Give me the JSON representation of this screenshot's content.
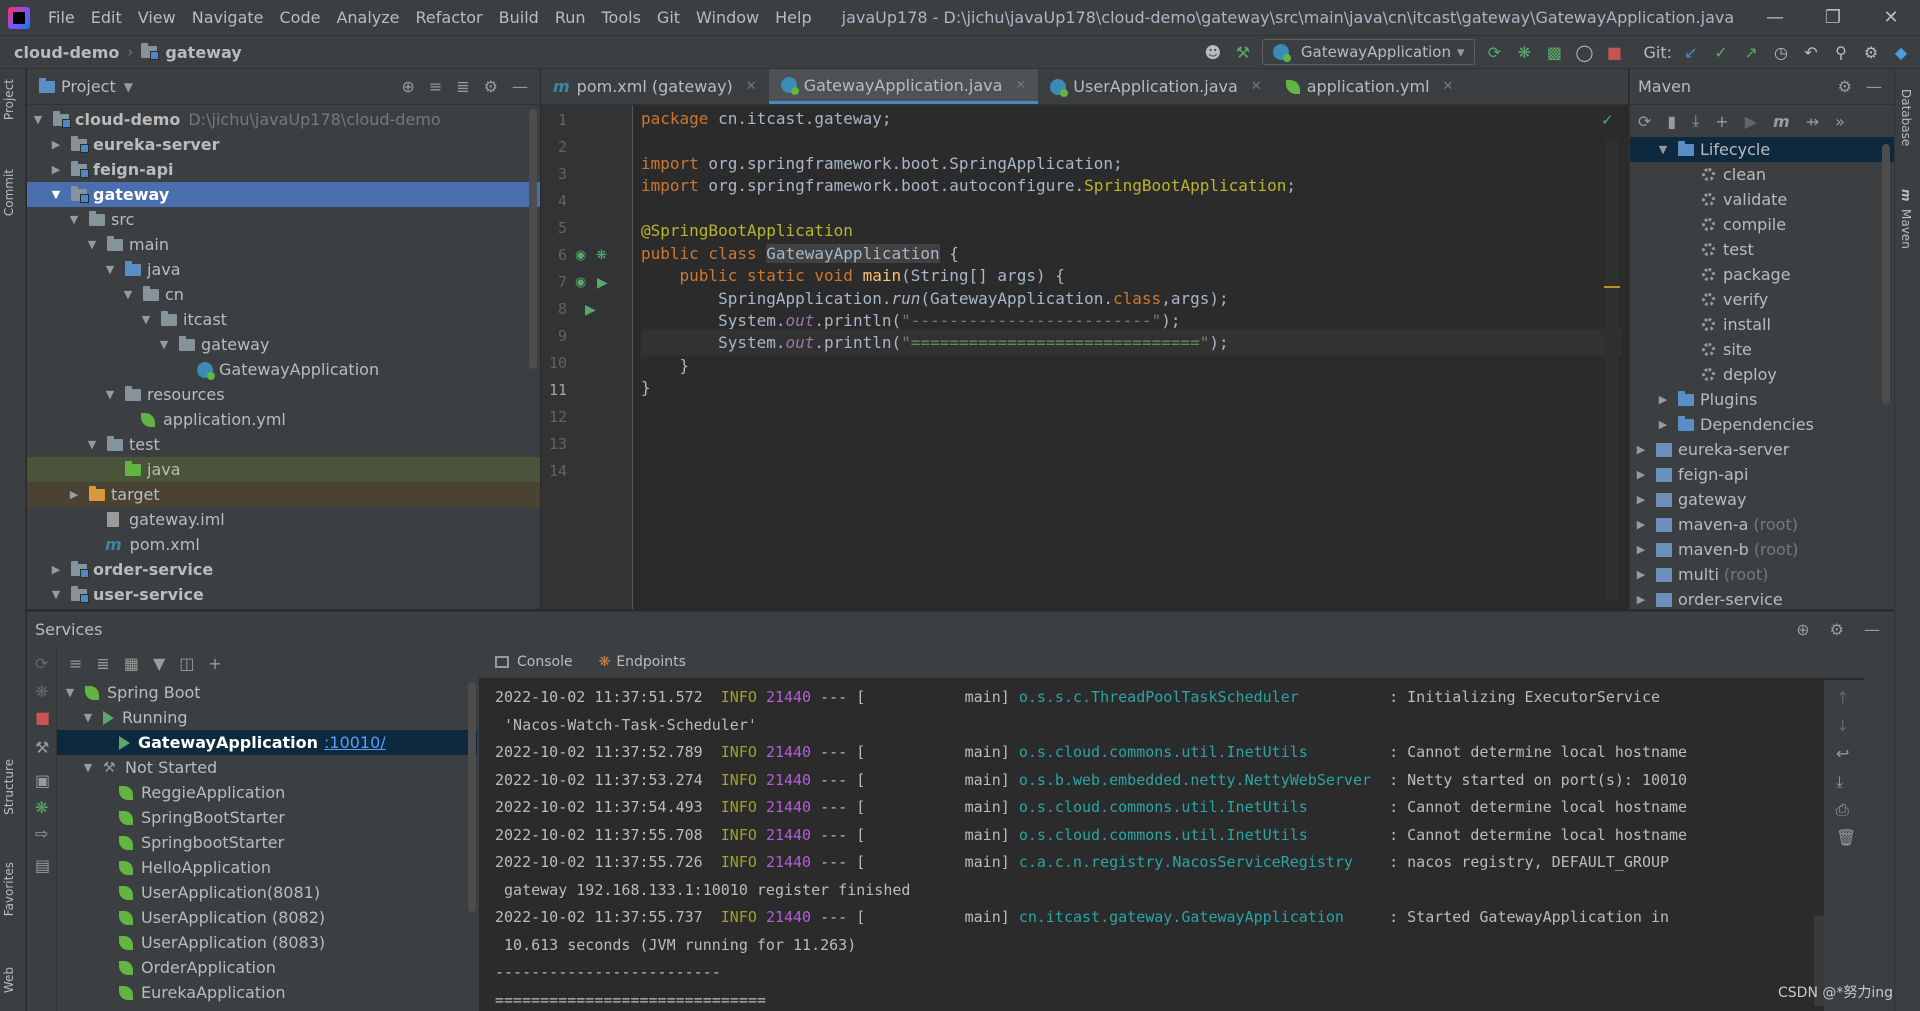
{
  "menubar": {
    "items": [
      "File",
      "Edit",
      "View",
      "Navigate",
      "Code",
      "Analyze",
      "Refactor",
      "Build",
      "Run",
      "Tools",
      "Git",
      "Window",
      "Help"
    ],
    "title": "javaUp178 - D:\\jichu\\javaUp178\\cloud-demo\\gateway\\src\\main\\java\\cn\\itcast\\gateway\\GatewayApplication.java"
  },
  "nav": {
    "crumbs": [
      "cloud-demo",
      "gateway"
    ],
    "run_config": "GatewayApplication",
    "git_label": "Git:"
  },
  "left_strip": {
    "project": "Project",
    "commit": "Commit",
    "structure": "Structure",
    "favorites": "Favorites",
    "web": "Web"
  },
  "right_strip": {
    "database": "Database",
    "maven": "Maven",
    "maven_m": "m"
  },
  "project": {
    "title": "Project",
    "tree": [
      {
        "label": "cloud-demo",
        "path": "D:\\jichu\\javaUp178\\cloud-demo"
      },
      {
        "label": "eureka-server"
      },
      {
        "label": "feign-api"
      },
      {
        "label": "gateway"
      },
      {
        "label": "src"
      },
      {
        "label": "main"
      },
      {
        "label": "java"
      },
      {
        "label": "cn"
      },
      {
        "label": "itcast"
      },
      {
        "label": "gateway"
      },
      {
        "label": "GatewayApplication"
      },
      {
        "label": "resources"
      },
      {
        "label": "application.yml"
      },
      {
        "label": "test"
      },
      {
        "label": "java"
      },
      {
        "label": "target"
      },
      {
        "label": "gateway.iml"
      },
      {
        "label": "pom.xml"
      },
      {
        "label": "order-service"
      },
      {
        "label": "user-service"
      }
    ]
  },
  "editor": {
    "tabs": [
      "pom.xml (gateway)",
      "GatewayApplication.java",
      "UserApplication.java",
      "application.yml"
    ],
    "line_numbers": [
      "1",
      "2",
      "3",
      "4",
      "5",
      "6",
      "7",
      "8",
      "9",
      "10",
      "11",
      "12",
      "13",
      "14"
    ],
    "code": {
      "l1_kw": "package",
      "l1_rest": " cn.itcast.gateway;",
      "l3_kw": "import",
      "l3_rest": " org.springframework.boot.SpringApplication;",
      "l4_kw": "import",
      "l4_rest": " org.springframework.boot.autoconfigure.",
      "l4_cls": "SpringBootApplication",
      "l4_end": ";",
      "l6": "@SpringBootApplication",
      "l7_kw": "public class ",
      "l7_cls": "GatewayApplication",
      "l7_end": " {",
      "l8_indent": "    ",
      "l8_kw": "public static void ",
      "l8_fn": "main",
      "l8_end": "(String[] args) {",
      "l9_a": "        SpringApplication.",
      "l9_run": "run",
      "l9_b": "(GatewayApplication.",
      "l9_kw": "class",
      "l9_c": ",args);",
      "l10_a": "        System.",
      "l10_out": "out",
      "l10_b": ".println(",
      "l10_str": "\"-------------------------\"",
      "l10_c": ");",
      "l11_a": "        System.",
      "l11_out": "out",
      "l11_b": ".println(",
      "l11_str": "\"==============================\"",
      "l11_c": ");",
      "l12": "    }",
      "l13": "}"
    }
  },
  "maven": {
    "title": "Maven",
    "lifecycle": "Lifecycle",
    "goals": [
      "clean",
      "validate",
      "compile",
      "test",
      "package",
      "verify",
      "install",
      "site",
      "deploy"
    ],
    "plugins": "Plugins",
    "dependencies": "Dependencies",
    "modules": [
      {
        "name": "eureka-server",
        "tag": ""
      },
      {
        "name": "feign-api",
        "tag": ""
      },
      {
        "name": "gateway",
        "tag": ""
      },
      {
        "name": "maven-a",
        "tag": "(root)"
      },
      {
        "name": "maven-b",
        "tag": "(root)"
      },
      {
        "name": "multi",
        "tag": "(root)"
      },
      {
        "name": "order-service",
        "tag": ""
      }
    ]
  },
  "services": {
    "title": "Services",
    "spring_boot": "Spring Boot",
    "running": "Running",
    "running_app": "GatewayApplication",
    "running_port": ":10010/",
    "not_started": "Not Started",
    "apps": [
      "ReggieApplication",
      "SpringBootStarter",
      "SpringbootStarter",
      "HelloApplication",
      "UserApplication(8081)",
      "UserApplication (8082)",
      "UserApplication (8083)",
      "OrderApplication",
      "EurekaApplication"
    ]
  },
  "console": {
    "tabs": [
      "Console",
      "Endpoints"
    ],
    "lines": [
      {
        "ts": "2022-10-02 11:37:51.572",
        "lvl": "INFO",
        "pid": "21440",
        "thread": " --- [           main] ",
        "cls": "o.s.s.c.ThreadPoolTaskScheduler         ",
        "msg": " : Initializing ExecutorService"
      },
      {
        "cont": " 'Nacos-Watch-Task-Scheduler'"
      },
      {
        "ts": "2022-10-02 11:37:52.789",
        "lvl": "INFO",
        "pid": "21440",
        "thread": " --- [           main] ",
        "cls": "o.s.cloud.commons.util.InetUtils        ",
        "msg": " : Cannot determine local hostname"
      },
      {
        "ts": "2022-10-02 11:37:53.274",
        "lvl": "INFO",
        "pid": "21440",
        "thread": " --- [           main] ",
        "cls": "o.s.b.web.embedded.netty.NettyWebServer ",
        "msg": " : Netty started on port(s): 10010"
      },
      {
        "ts": "2022-10-02 11:37:54.493",
        "lvl": "INFO",
        "pid": "21440",
        "thread": " --- [           main] ",
        "cls": "o.s.cloud.commons.util.InetUtils        ",
        "msg": " : Cannot determine local hostname"
      },
      {
        "ts": "2022-10-02 11:37:55.708",
        "lvl": "INFO",
        "pid": "21440",
        "thread": " --- [           main] ",
        "cls": "o.s.cloud.commons.util.InetUtils        ",
        "msg": " : Cannot determine local hostname"
      },
      {
        "ts": "2022-10-02 11:37:55.726",
        "lvl": "INFO",
        "pid": "21440",
        "thread": " --- [           main] ",
        "cls": "c.a.c.n.registry.NacosServiceRegistry   ",
        "msg": " : nacos registry, DEFAULT_GROUP"
      },
      {
        "cont": " gateway 192.168.133.1:10010 register finished"
      },
      {
        "ts": "2022-10-02 11:37:55.737",
        "lvl": "INFO",
        "pid": "21440",
        "thread": " --- [           main] ",
        "cls": "cn.itcast.gateway.GatewayApplication    ",
        "msg": " : Started GatewayApplication in"
      },
      {
        "cont": " 10.613 seconds (JVM running for 11.263)"
      },
      {
        "cont": "-------------------------"
      },
      {
        "cont": "=============================="
      }
    ]
  },
  "watermark": "CSDN @*努力ing",
  "colors": {
    "accent": "#4a88c7",
    "selection": "#4b6eaf",
    "bg": "#2b2b2b",
    "panel": "#3c3f41"
  }
}
